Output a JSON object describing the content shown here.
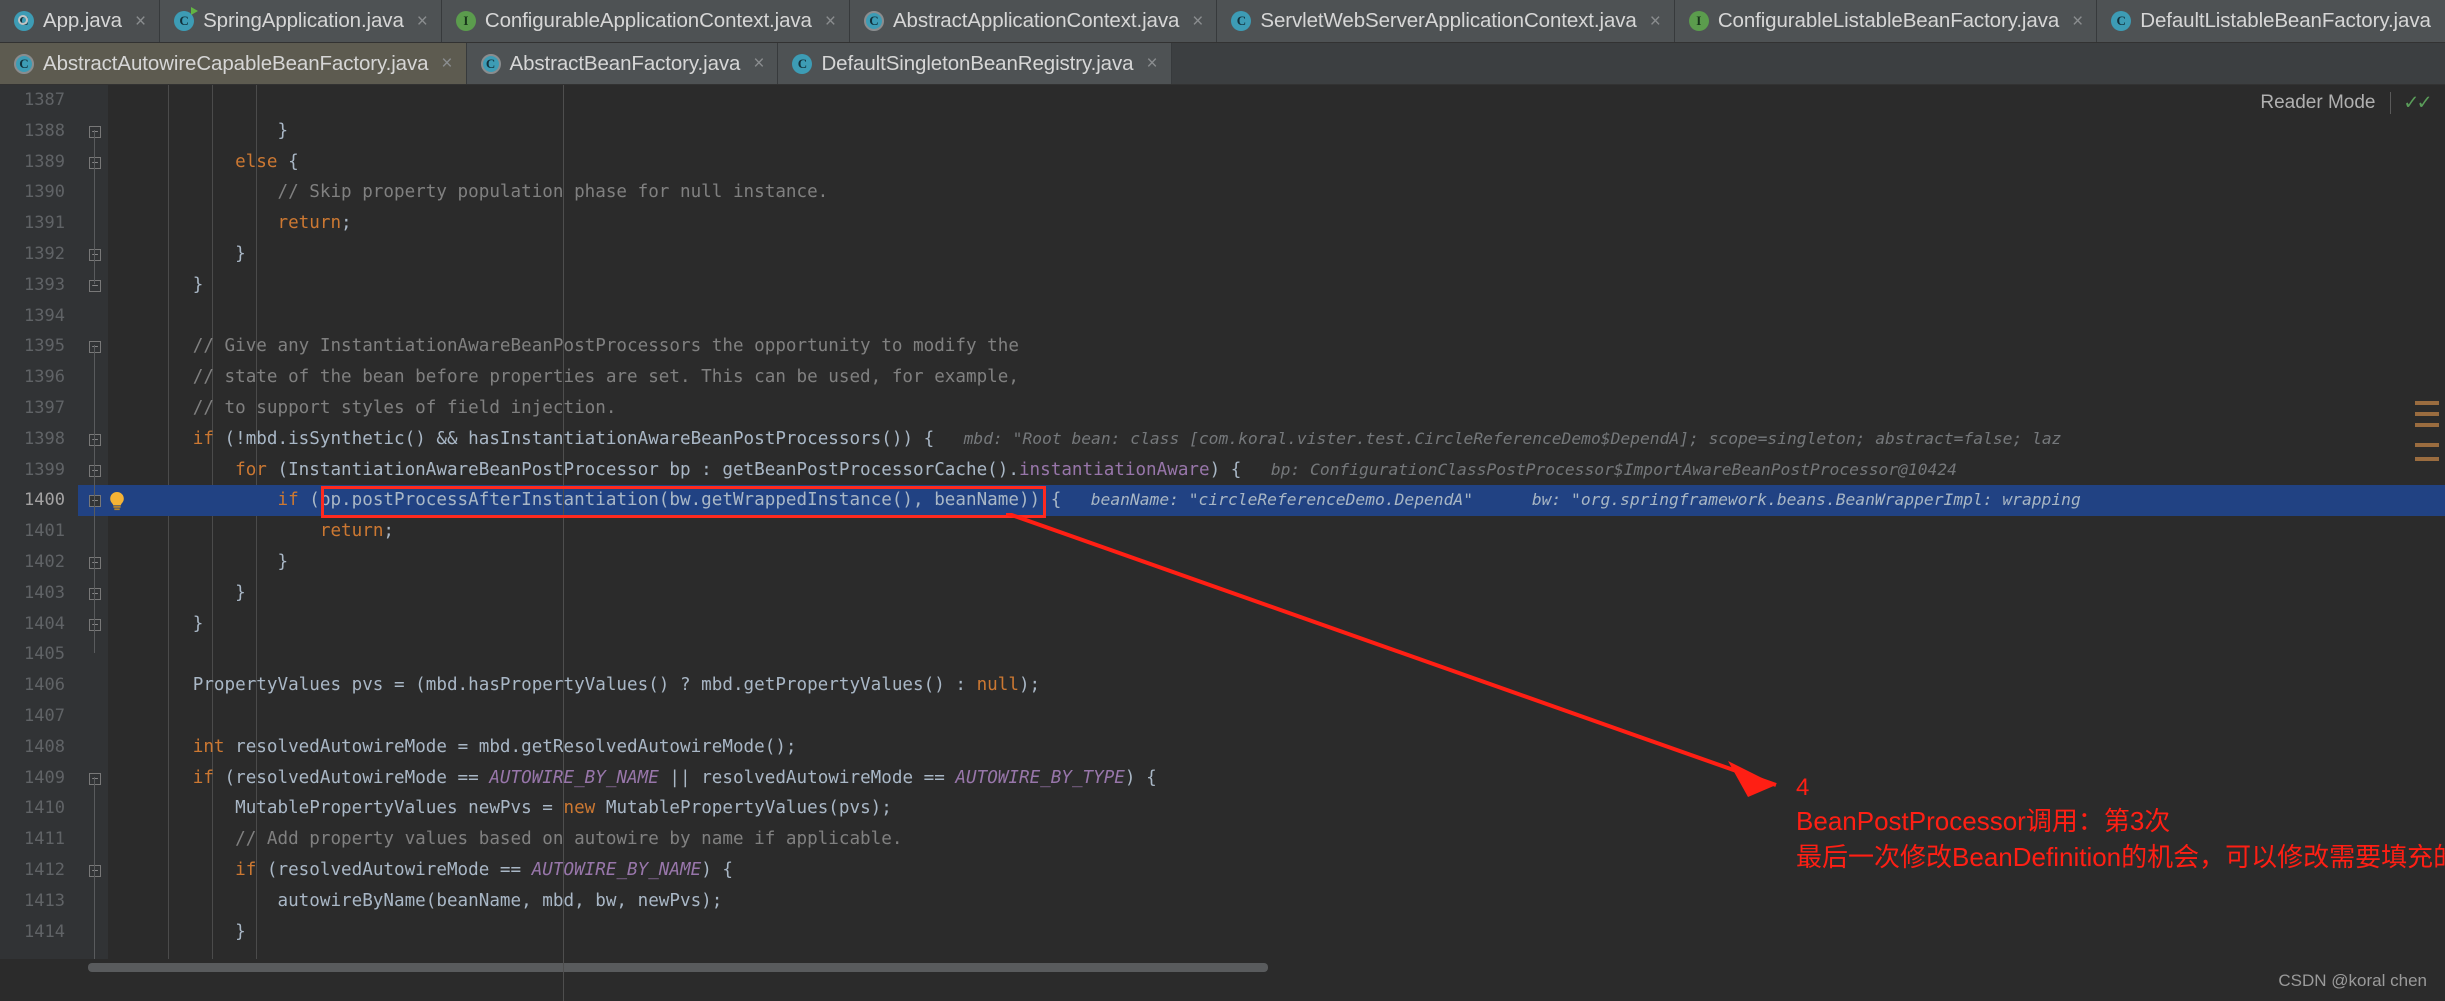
{
  "window": {
    "app": "IntelliJ IDEA Editor",
    "watermark": "CSDN @koral chen"
  },
  "tabs_row1": [
    {
      "label": "App.java",
      "icon": "java-class-run-icon",
      "kind": "run",
      "close": "×",
      "state": "active"
    },
    {
      "label": "SpringApplication.java",
      "icon": "java-class-run-icon",
      "kind": "run",
      "close": "×",
      "state": "normal"
    },
    {
      "label": "ConfigurableApplicationContext.java",
      "icon": "java-interface-icon",
      "kind": "interface",
      "close": "×",
      "state": "normal"
    },
    {
      "label": "AbstractApplicationContext.java",
      "icon": "java-abstract-class-icon",
      "kind": "abstract",
      "close": "×",
      "state": "normal"
    },
    {
      "label": "ServletWebServerApplicationContext.java",
      "icon": "java-class-icon",
      "kind": "class",
      "close": "×",
      "state": "normal"
    },
    {
      "label": "ConfigurableListableBeanFactory.java",
      "icon": "java-interface-icon",
      "kind": "interface",
      "close": "×",
      "state": "normal"
    },
    {
      "label": "DefaultListableBeanFactory.java",
      "icon": "java-class-icon",
      "kind": "class",
      "close": "×",
      "state": "normal"
    }
  ],
  "tabs_row2": [
    {
      "label": "AbstractAutowireCapableBeanFactory.java",
      "icon": "java-abstract-class-icon",
      "kind": "abstract",
      "close": "×",
      "state": "selected"
    },
    {
      "label": "AbstractBeanFactory.java",
      "icon": "java-abstract-class-icon",
      "kind": "abstract",
      "close": "×",
      "state": "normal"
    },
    {
      "label": "DefaultSingletonBeanRegistry.java",
      "icon": "java-class-icon",
      "kind": "class",
      "close": "×",
      "state": "normal"
    }
  ],
  "tab_overflow": "⋮",
  "reader_mode": {
    "label": "Reader Mode",
    "check": "✓✓"
  },
  "editor": {
    "first_line": 1387,
    "current_line": 1400,
    "lines": [
      {
        "n": 1387,
        "indent": 0,
        "tokens": []
      },
      {
        "n": 1388,
        "indent": 0,
        "tokens": [
          {
            "t": "\t\t\t\t}",
            "c": "pln"
          }
        ]
      },
      {
        "n": 1389,
        "indent": 0,
        "tokens": [
          {
            "t": "\t\t\t",
            "c": "pln"
          },
          {
            "t": "else",
            "c": "kw"
          },
          {
            "t": " {",
            "c": "pln"
          }
        ]
      },
      {
        "n": 1390,
        "indent": 0,
        "tokens": [
          {
            "t": "\t\t\t\t// Skip property population phase for null instance.",
            "c": "cmt"
          }
        ]
      },
      {
        "n": 1391,
        "indent": 0,
        "tokens": [
          {
            "t": "\t\t\t\t",
            "c": "pln"
          },
          {
            "t": "return",
            "c": "kw"
          },
          {
            "t": ";",
            "c": "pln"
          }
        ]
      },
      {
        "n": 1392,
        "indent": 0,
        "tokens": [
          {
            "t": "\t\t\t}",
            "c": "pln"
          }
        ]
      },
      {
        "n": 1393,
        "indent": 0,
        "tokens": [
          {
            "t": "\t\t}",
            "c": "pln"
          }
        ]
      },
      {
        "n": 1394,
        "indent": 0,
        "tokens": []
      },
      {
        "n": 1395,
        "indent": 0,
        "tokens": [
          {
            "t": "\t\t// Give any InstantiationAwareBeanPostProcessors the opportunity to modify the",
            "c": "cmt"
          }
        ]
      },
      {
        "n": 1396,
        "indent": 0,
        "tokens": [
          {
            "t": "\t\t// state of the bean before properties are set. This can be used, for example,",
            "c": "cmt"
          }
        ]
      },
      {
        "n": 1397,
        "indent": 0,
        "tokens": [
          {
            "t": "\t\t// to support styles of field injection.",
            "c": "cmt"
          }
        ]
      },
      {
        "n": 1398,
        "indent": 0,
        "tokens": [
          {
            "t": "\t\t",
            "c": "pln"
          },
          {
            "t": "if",
            "c": "kw"
          },
          {
            "t": " (!mbd.isSynthetic() && hasInstantiationAwareBeanPostProcessors()) {",
            "c": "pln"
          }
        ],
        "hint": "mbd: \"Root bean: class [com.koral.vister.test.CircleReferenceDemo$DependA]; scope=singleton; abstract=false; laz"
      },
      {
        "n": 1399,
        "indent": 0,
        "tokens": [
          {
            "t": "\t\t\t",
            "c": "pln"
          },
          {
            "t": "for",
            "c": "kw"
          },
          {
            "t": " (InstantiationAwareBeanPostProcessor bp : getBeanPostProcessorCache().",
            "c": "pln"
          },
          {
            "t": "instantiationAware",
            "c": "fld"
          },
          {
            "t": ") {",
            "c": "pln"
          }
        ],
        "hint": "bp: ConfigurationClassPostProcessor$ImportAwareBeanPostProcessor@10424"
      },
      {
        "n": 1400,
        "indent": 0,
        "highlight": true,
        "bulb": true,
        "tokens": [
          {
            "t": "\t\t\t\t",
            "c": "pln"
          },
          {
            "t": "if",
            "c": "kw"
          },
          {
            "t": " (bp.postProcessAfterInstantiation(bw.getWrappedInstance(), beanName)) {",
            "c": "pln"
          }
        ],
        "hint": "beanName: \"circleReferenceDemo.DependA\"      bw: \"org.springframework.beans.BeanWrapperImpl: wrapping"
      },
      {
        "n": 1401,
        "indent": 0,
        "tokens": [
          {
            "t": "\t\t\t\t\t",
            "c": "pln"
          },
          {
            "t": "return",
            "c": "kw"
          },
          {
            "t": ";",
            "c": "pln"
          }
        ]
      },
      {
        "n": 1402,
        "indent": 0,
        "tokens": [
          {
            "t": "\t\t\t\t}",
            "c": "pln"
          }
        ]
      },
      {
        "n": 1403,
        "indent": 0,
        "tokens": [
          {
            "t": "\t\t\t}",
            "c": "pln"
          }
        ]
      },
      {
        "n": 1404,
        "indent": 0,
        "tokens": [
          {
            "t": "\t\t}",
            "c": "pln"
          }
        ]
      },
      {
        "n": 1405,
        "indent": 0,
        "tokens": []
      },
      {
        "n": 1406,
        "indent": 0,
        "tokens": [
          {
            "t": "\t\tPropertyValues pvs = (mbd.hasPropertyValues() ? mbd.getPropertyValues() : ",
            "c": "pln"
          },
          {
            "t": "null",
            "c": "kw"
          },
          {
            "t": ");",
            "c": "pln"
          }
        ]
      },
      {
        "n": 1407,
        "indent": 0,
        "tokens": []
      },
      {
        "n": 1408,
        "indent": 0,
        "tokens": [
          {
            "t": "\t\t",
            "c": "pln"
          },
          {
            "t": "int",
            "c": "kw"
          },
          {
            "t": " resolvedAutowireMode = mbd.getResolvedAutowireMode();",
            "c": "pln"
          }
        ]
      },
      {
        "n": 1409,
        "indent": 0,
        "tokens": [
          {
            "t": "\t\t",
            "c": "pln"
          },
          {
            "t": "if",
            "c": "kw"
          },
          {
            "t": " (resolvedAutowireMode == ",
            "c": "pln"
          },
          {
            "t": "AUTOWIRE_BY_NAME",
            "c": "cnst"
          },
          {
            "t": " || resolvedAutowireMode == ",
            "c": "pln"
          },
          {
            "t": "AUTOWIRE_BY_TYPE",
            "c": "cnst"
          },
          {
            "t": ") {",
            "c": "pln"
          }
        ]
      },
      {
        "n": 1410,
        "indent": 0,
        "tokens": [
          {
            "t": "\t\t\tMutablePropertyValues newPvs = ",
            "c": "pln"
          },
          {
            "t": "new",
            "c": "kw"
          },
          {
            "t": " MutablePropertyValues(pvs);",
            "c": "pln"
          }
        ]
      },
      {
        "n": 1411,
        "indent": 0,
        "tokens": [
          {
            "t": "\t\t\t// Add property values based on autowire by name if applicable.",
            "c": "cmt"
          }
        ]
      },
      {
        "n": 1412,
        "indent": 0,
        "tokens": [
          {
            "t": "\t\t\t",
            "c": "pln"
          },
          {
            "t": "if",
            "c": "kw"
          },
          {
            "t": " (resolvedAutowireMode == ",
            "c": "pln"
          },
          {
            "t": "AUTOWIRE_BY_NAME",
            "c": "cnst"
          },
          {
            "t": ") {",
            "c": "pln"
          }
        ]
      },
      {
        "n": 1413,
        "indent": 0,
        "tokens": [
          {
            "t": "\t\t\t\tautowireByName(beanName, mbd, bw, newPvs);",
            "c": "pln"
          }
        ]
      },
      {
        "n": 1414,
        "indent": 0,
        "tokens": [
          {
            "t": "\t\t\t}",
            "c": "pln"
          }
        ]
      }
    ],
    "fold_markers": [
      1388,
      1389,
      1392,
      1393,
      1395,
      1398,
      1399,
      1400,
      1402,
      1403,
      1404,
      1409,
      1412
    ],
    "selection_box_label": "bp.postProcessAfterInstantiation(bw.getWrappedInstance(), beanName))"
  },
  "annotation": {
    "number": "4",
    "line1": "BeanPostProcessor调用：第3次",
    "line2": "最后一次修改BeanDefinition的机会，可以修改需要填充的属性等",
    "color": "#ff1f14"
  },
  "colors": {
    "background": "#2b2b2b",
    "gutter": "#313335",
    "tabbar": "#3c3f41",
    "selection": "#214283",
    "keyword": "#cc7832",
    "comment": "#808080",
    "string": "#6a8759",
    "field": "#9876aa",
    "annotation_red": "#ff1f14",
    "mark_stripe": "#9a6c3f"
  }
}
